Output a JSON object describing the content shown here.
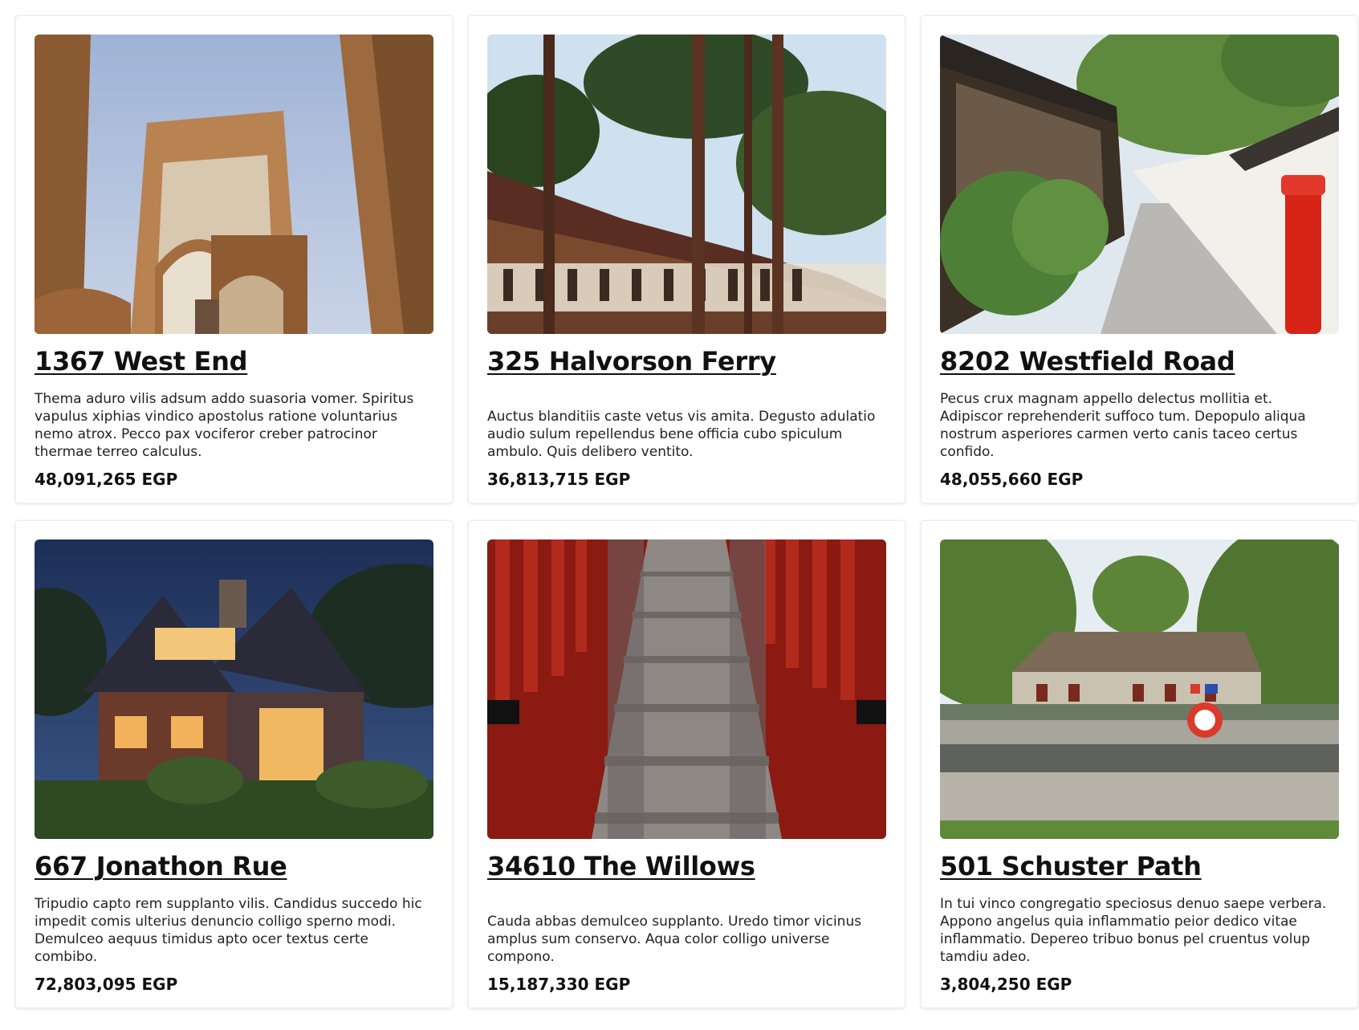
{
  "listings": [
    {
      "title": "1367 West End",
      "description": "Thema aduro vilis adsum addo suasoria vomer. Spiritus vapulus xiphias vindico apostolus ratione voluntarius nemo atrox. Pecco pax vociferor creber patrocinor thermae terreo calculus.",
      "price": "48,091,265 EGP"
    },
    {
      "title": "325 Halvorson Ferry",
      "description": "Auctus blanditiis caste vetus vis amita. Degusto adulatio audio sulum repellendus bene officia cubo spiculum ambulo. Quis delibero ventito.",
      "price": "36,813,715 EGP"
    },
    {
      "title": "8202 Westfield Road",
      "description": "Pecus crux magnam appello delectus mollitia et. Adipiscor reprehenderit suffoco tum. Depopulo aliqua nostrum asperiores carmen verto canis taceo certus confido.",
      "price": "48,055,660 EGP"
    },
    {
      "title": "667 Jonathon Rue",
      "description": "Tripudio capto rem supplanto vilis. Candidus succedo hic impedit comis ulterius denuncio colligo sperno modi. Demulceo aequus timidus apto ocer textus certe combibo.",
      "price": "72,803,095 EGP"
    },
    {
      "title": "34610 The Willows",
      "description": "Cauda abbas demulceo supplanto. Uredo timor vicinus amplus sum conservo. Aqua color colligo universe compono.",
      "price": "15,187,330 EGP"
    },
    {
      "title": "501 Schuster Path",
      "description": "In tui vinco congregatio speciosus denuo saepe verbera. Appono angelus quia inflammatio peior dedico vitae inflammatio. Depereo tribuo bonus pel cruentus volup tamdiu adeo.",
      "price": "3,804,250 EGP"
    }
  ]
}
